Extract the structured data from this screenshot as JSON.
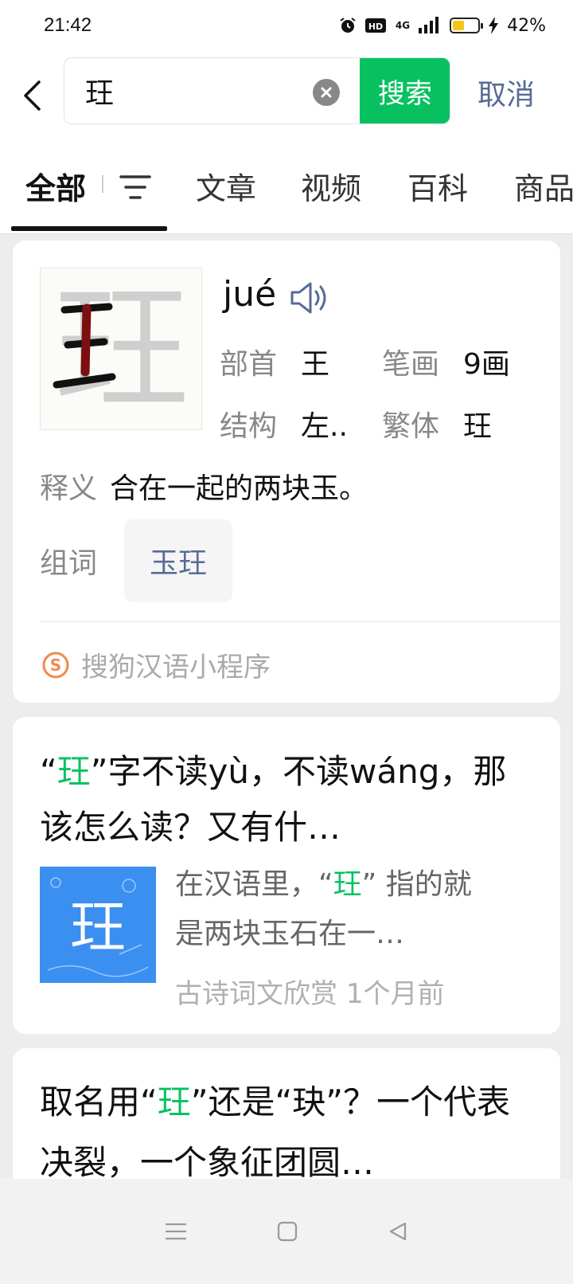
{
  "status_bar": {
    "time": "21:42",
    "network": "4G",
    "battery": "42%",
    "battery_level": 0.42,
    "icons": [
      "alarm-icon",
      "hd-icon",
      "signal-icon",
      "battery-icon",
      "charging-icon"
    ]
  },
  "search": {
    "query": "玨",
    "search_label": "搜索",
    "cancel_label": "取消"
  },
  "tabs": [
    {
      "label": "全部",
      "active": true
    },
    {
      "label": "文章",
      "active": false
    },
    {
      "label": "视频",
      "active": false
    },
    {
      "label": "百科",
      "active": false
    },
    {
      "label": "商品",
      "active": false
    }
  ],
  "dictionary_card": {
    "character": "玨",
    "pinyin": "jué",
    "radical_label": "部首",
    "radical": "王",
    "strokes_label": "笔画",
    "strokes": "9画",
    "structure_label": "结构",
    "structure": "左..",
    "traditional_label": "繁体",
    "traditional": "玨",
    "definition_label": "释义",
    "definition": "合在一起的两块玉。",
    "words_label": "组词",
    "words": [
      "玉玨"
    ],
    "source": "搜狗汉语小程序"
  },
  "articles": [
    {
      "title_before": "“",
      "title_highlight": "玨",
      "title_after": "”字不读yù，不读wáng，那该怎么读？又有什…",
      "desc_before": "在汉语里，“",
      "desc_highlight": "玨",
      "desc_after": "” 指的就是两块玉石在一…",
      "thumb_char": "玨",
      "source": "古诗词文欣赏",
      "time": "1个月前"
    },
    {
      "title_before": "取名用“",
      "title_highlight": "玨",
      "title_after": "”还是“玦”？一个代表决裂，一个象征团圆…"
    }
  ],
  "colors": {
    "accent_green": "#07c160",
    "link_blue": "#576b95",
    "background": "#ededed"
  }
}
